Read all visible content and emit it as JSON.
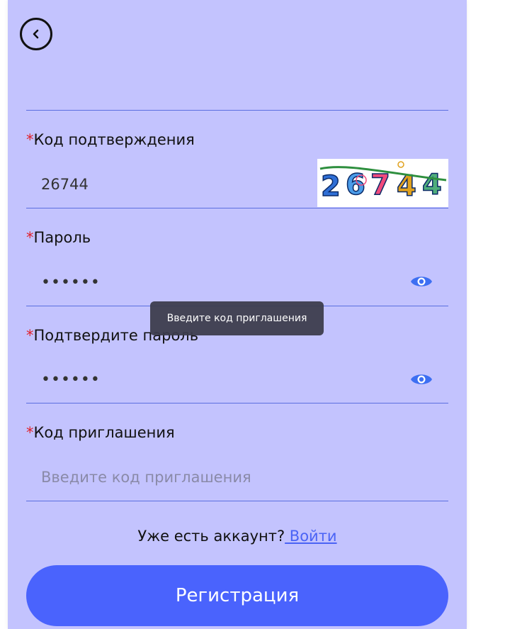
{
  "header": {
    "back_icon": "chevron-left-icon"
  },
  "fields": {
    "captcha": {
      "required_mark": "*",
      "label": "Код подтверждения",
      "value": "26744"
    },
    "password": {
      "required_mark": "*",
      "label": "Пароль",
      "value_masked": "••••••",
      "icon": "eye-icon"
    },
    "confirm_password": {
      "required_mark": "*",
      "label": "Подтвердите пароль",
      "value_masked": "••••••",
      "icon": "eye-icon"
    },
    "invite_code": {
      "required_mark": "*",
      "label": "Код приглашения",
      "placeholder": "Введите код приглашения"
    }
  },
  "tooltip": {
    "text": "Введите код приглашения"
  },
  "login_prompt": {
    "text": "Уже есть аккаунт?",
    "link": " Войти"
  },
  "register_button": {
    "label": "Регистрация"
  },
  "colors": {
    "background": "#c3c3fe",
    "accent": "#4a63fd",
    "required": "#e0202a",
    "divider": "#5b6fe0"
  }
}
